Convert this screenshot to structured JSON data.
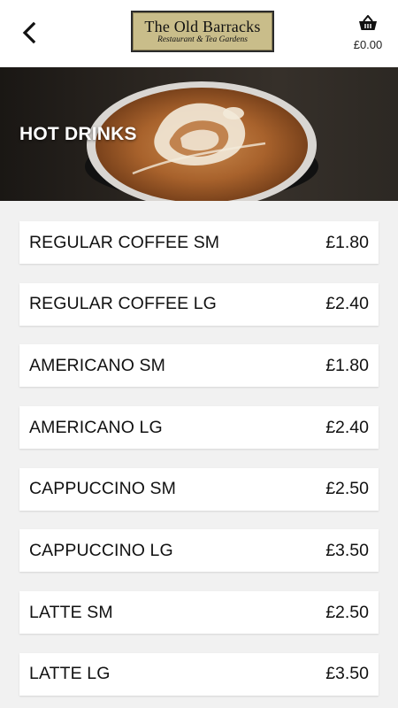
{
  "header": {
    "logo_title": "The Old Barracks",
    "logo_subtitle": "Restaurant & Tea Gardens",
    "basket_total": "£0.00"
  },
  "hero": {
    "title": "HOT DRINKS"
  },
  "menu": {
    "items": [
      {
        "name": "REGULAR COFFEE SM",
        "price": "£1.80"
      },
      {
        "name": "REGULAR COFFEE LG",
        "price": "£2.40"
      },
      {
        "name": "AMERICANO SM",
        "price": "£1.80"
      },
      {
        "name": "AMERICANO LG",
        "price": "£2.40"
      },
      {
        "name": "CAPPUCCINO SM",
        "price": "£2.50"
      },
      {
        "name": "CAPPUCCINO LG",
        "price": "£3.50"
      },
      {
        "name": "LATTE SM",
        "price": "£2.50"
      },
      {
        "name": "LATTE LG",
        "price": "£3.50"
      }
    ]
  },
  "icons": {
    "back": "chevron-left-icon",
    "basket": "basket-icon"
  }
}
